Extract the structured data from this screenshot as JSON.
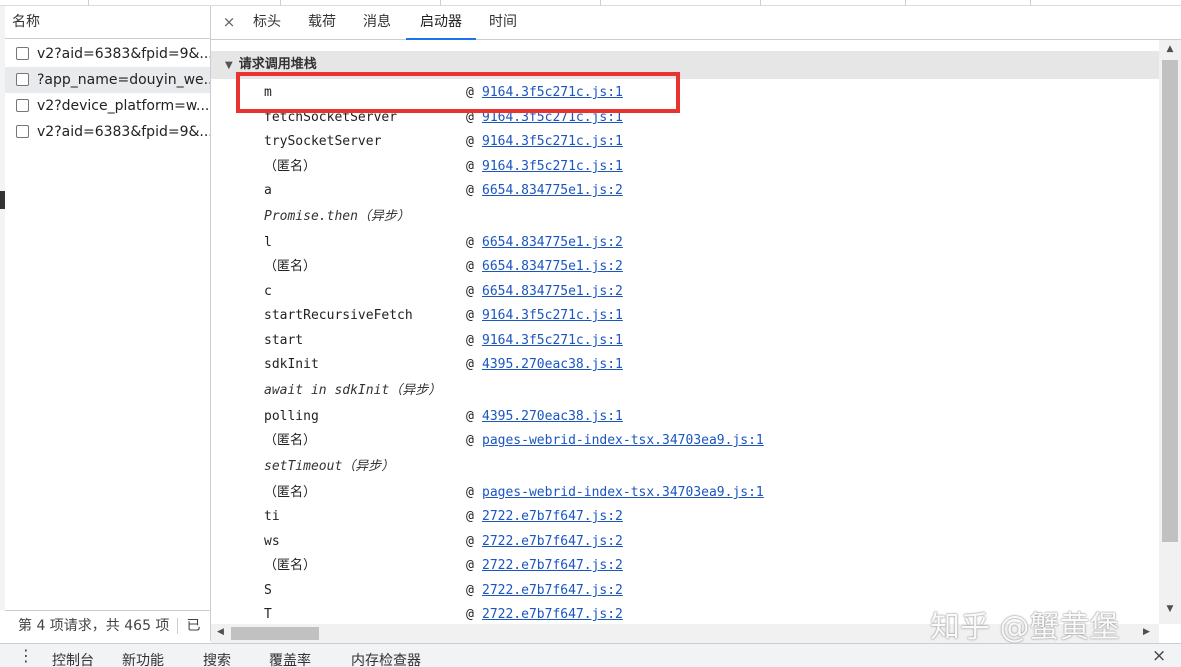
{
  "left_panel": {
    "header": "名称",
    "requests": [
      {
        "name": "v2?aid=6383&fpid=9&..."
      },
      {
        "name": "?app_name=douyin_we..."
      },
      {
        "name": "v2?device_platform=w..."
      },
      {
        "name": "v2?aid=6383&fpid=9&..."
      }
    ],
    "status_text": "第 4 项请求，共 465 项",
    "status_extra": "已"
  },
  "tabs": {
    "close_glyph": "×",
    "items": [
      "标头",
      "载荷",
      "消息",
      "启动器",
      "时间"
    ],
    "active": "启动器"
  },
  "section": {
    "expand_glyph": "▼",
    "title": "请求调用堆栈"
  },
  "call_stack": [
    {
      "fn": "m",
      "at": "@",
      "link": "9164.3f5c271c.js:1"
    },
    {
      "fn": "fetchSocketServer",
      "at": "@",
      "link": "9164.3f5c271c.js:1"
    },
    {
      "fn": "trySocketServer",
      "at": "@",
      "link": "9164.3f5c271c.js:1"
    },
    {
      "fn": "（匿名）",
      "at": "@",
      "link": "9164.3f5c271c.js:1"
    },
    {
      "fn": "a",
      "at": "@",
      "link": "6654.834775e1.js:2"
    },
    {
      "fn": "Promise.then（异步）",
      "async": true
    },
    {
      "fn": "l",
      "at": "@",
      "link": "6654.834775e1.js:2"
    },
    {
      "fn": "（匿名）",
      "at": "@",
      "link": "6654.834775e1.js:2"
    },
    {
      "fn": "c",
      "at": "@",
      "link": "6654.834775e1.js:2"
    },
    {
      "fn": "startRecursiveFetch",
      "at": "@",
      "link": "9164.3f5c271c.js:1"
    },
    {
      "fn": "start",
      "at": "@",
      "link": "9164.3f5c271c.js:1"
    },
    {
      "fn": "sdkInit",
      "at": "@",
      "link": "4395.270eac38.js:1"
    },
    {
      "fn": "await in sdkInit（异步）",
      "async": true
    },
    {
      "fn": "polling",
      "at": "@",
      "link": "4395.270eac38.js:1"
    },
    {
      "fn": "（匿名）",
      "at": "@",
      "link": "pages-webrid-index-tsx.34703ea9.js:1"
    },
    {
      "fn": "setTimeout（异步）",
      "async": true
    },
    {
      "fn": "（匿名）",
      "at": "@",
      "link": "pages-webrid-index-tsx.34703ea9.js:1"
    },
    {
      "fn": "ti",
      "at": "@",
      "link": "2722.e7b7f647.js:2"
    },
    {
      "fn": "ws",
      "at": "@",
      "link": "2722.e7b7f647.js:2"
    },
    {
      "fn": "（匿名）",
      "at": "@",
      "link": "2722.e7b7f647.js:2"
    },
    {
      "fn": "S",
      "at": "@",
      "link": "2722.e7b7f647.js:2"
    },
    {
      "fn": "T",
      "at": "@",
      "link": "2722.e7b7f647.js:2"
    }
  ],
  "scroll": {
    "up_glyph": "▲",
    "down_glyph": "▼",
    "left_glyph": "◀",
    "right_glyph": "▶"
  },
  "watermark": "知乎 @蟹黄堡",
  "drawer": {
    "menu_glyph": "⋮",
    "tabs": [
      "控制台",
      "新功能",
      "搜索",
      "覆盖率",
      "内存检查器"
    ],
    "close_glyph": "×"
  },
  "colors": {
    "link": "#1a55c0",
    "highlight_box": "#e8332e",
    "active_tab": "#1a73e8",
    "selected_row": "#e8eaed"
  }
}
